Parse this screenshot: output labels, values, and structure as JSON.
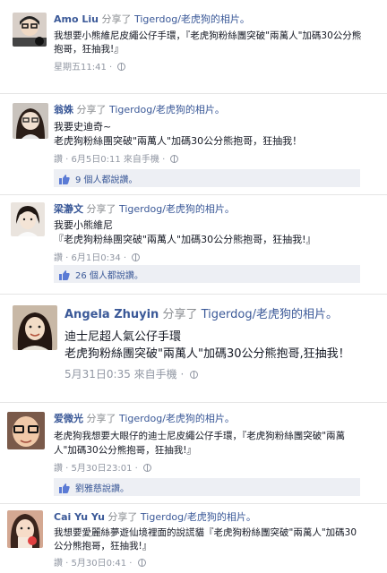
{
  "posts": [
    {
      "name": "Amo Liu",
      "shared": "分享了",
      "page": "Tigerdog/老虎狗",
      "photo": "的相片。",
      "lines": [
        "我想要小熊維尼皮繩公仔手環，『老虎狗粉絲團突破\"兩萬人\"加碼30公分熊",
        "抱哥，狂抽我!』"
      ],
      "time": "星期五11:41 · ",
      "via": "",
      "likes": ""
    },
    {
      "name": "翁姝",
      "shared": "分享了",
      "page": "Tigerdog/老虎狗",
      "photo": "的相片。",
      "lines": [
        "我要史迪奇~",
        "老虎狗粉絲團突破\"兩萬人\"加碼30公分熊抱哥，狂抽我！"
      ],
      "time": "讚 · 6月5日0:11 ",
      "via": "來自手機 · ",
      "likes": "9 個人都說讚。"
    },
    {
      "name": "梁瀞文",
      "shared": "分享了",
      "page": "Tigerdog/老虎狗",
      "photo": "的相片。",
      "lines": [
        "我要小熊維尼",
        "『老虎狗粉絲團突破\"兩萬人\"加碼30公分熊抱哥，狂抽我!』"
      ],
      "time": "讚 · 6月1日0:34 · ",
      "via": "",
      "likes": "26 個人都說讚。"
    },
    {
      "name": "Angela Zhuyin",
      "shared": "分享了",
      "page": "Tigerdog/老虎狗",
      "photo": "的相片。",
      "lines": [
        "迪士尼超人氣公仔手環",
        "老虎狗粉絲團突破\"兩萬人\"加碼30公分熊抱哥,狂抽我！"
      ],
      "time": "5月31日0:35 ",
      "via": "來自手機 · ",
      "likes": ""
    },
    {
      "name": "爱微光",
      "shared": "分享了",
      "page": "Tigerdog/老虎狗",
      "photo": "的相片。",
      "lines": [
        "老虎狗我想要大眼仔的迪士尼皮繩公仔手環，『老虎狗粉絲團突破\"兩萬",
        "人\"加碼30公分熊抱哥，狂抽我!』"
      ],
      "time": "讚 · 5月30日23:01 · ",
      "via": "",
      "likes": "劉雅慈說讚。"
    },
    {
      "name": "Cai Yu Yu",
      "shared": "分享了",
      "page": "Tigerdog/老虎狗",
      "photo": "的相片。",
      "lines": [
        "我想要愛麗絲夢遊仙境裡面的說謊貓『老虎狗粉絲團突破\"兩萬人\"加碼30",
        "公分熊抱哥，狂抽我!』"
      ],
      "time": "讚 · 5月30日0:41 · ",
      "via": "",
      "likes": ""
    }
  ]
}
